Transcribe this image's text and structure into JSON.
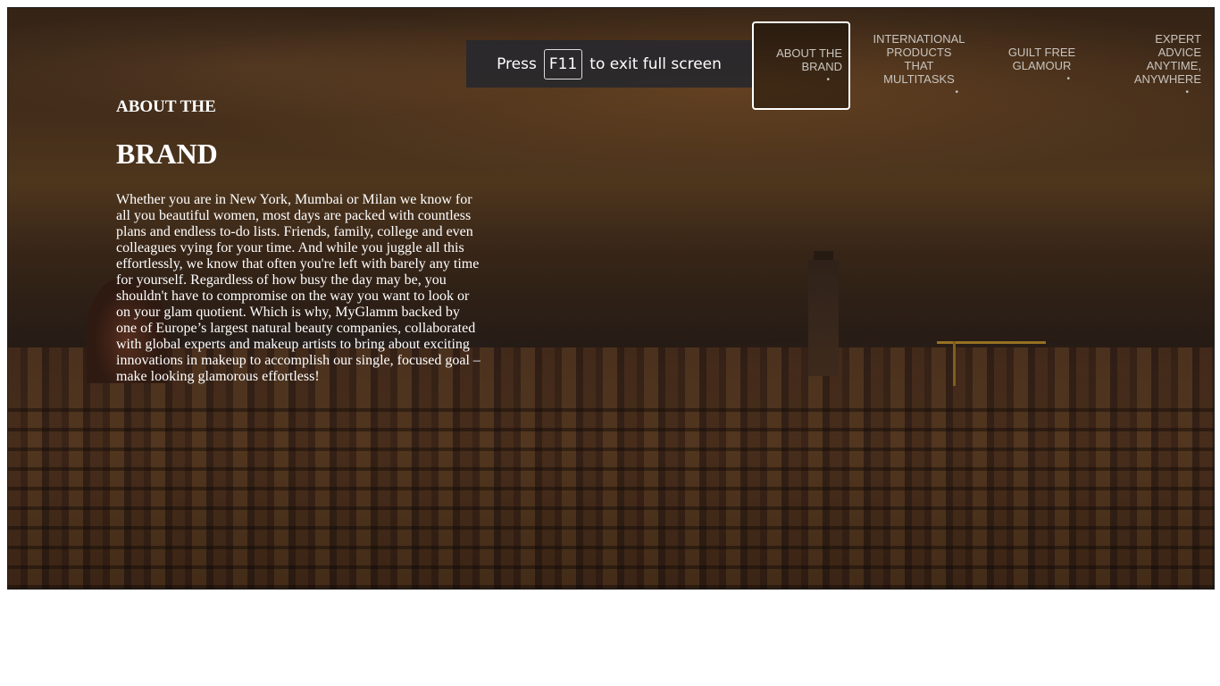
{
  "nav": {
    "items": [
      {
        "label": "ABOUT THE BRAND",
        "line1": "ABOUT THE",
        "line2": "BRAND",
        "active": true
      },
      {
        "label": "INTERNATIONAL PRODUCTS THAT MULTITASKS",
        "line1": "INTERNATIONAL",
        "line2": "PRODUCTS",
        "line3": "THAT",
        "line4": "MULTITASKS",
        "active": false
      },
      {
        "label": "GUILT FREE GLAMOUR",
        "line1": "GUILT FREE",
        "line2": "GLAMOUR",
        "active": false
      },
      {
        "label": "EXPERT ADVICE ANYTIME, ANYWHERE",
        "line1": "EXPERT",
        "line2": "ADVICE",
        "line3": "ANYTIME,",
        "line4": "ANYWHERE",
        "active": false
      }
    ],
    "bullet": "•"
  },
  "about": {
    "eyebrow": "ABOUT THE",
    "heading": "BRAND",
    "body": "Whether you are in New York, Mumbai or Milan we know for all you beautiful women, most days are packed with countless plans and endless to-do lists. Friends, family, college and even colleagues vying for your time. And while you juggle all this effortlessly, we know that often you're left with barely any time for yourself. Regardless of how busy the day may be, you shouldn't have to compromise on the way you want to look or on your glam quotient. Which is why, MyGlamm backed by one of Europe’s largest natural beauty companies, collaborated with global experts and makeup artists to bring about exciting innovations in makeup to accomplish our single, focused goal – make looking glamorous effortless!"
  },
  "fullscreen_banner": {
    "press": "Press",
    "key": "F11",
    "suffix": "to exit full screen"
  },
  "colors": {
    "text": "#ffffff",
    "nav_text": "#c9c4be",
    "banner_bg": "#28282c"
  }
}
